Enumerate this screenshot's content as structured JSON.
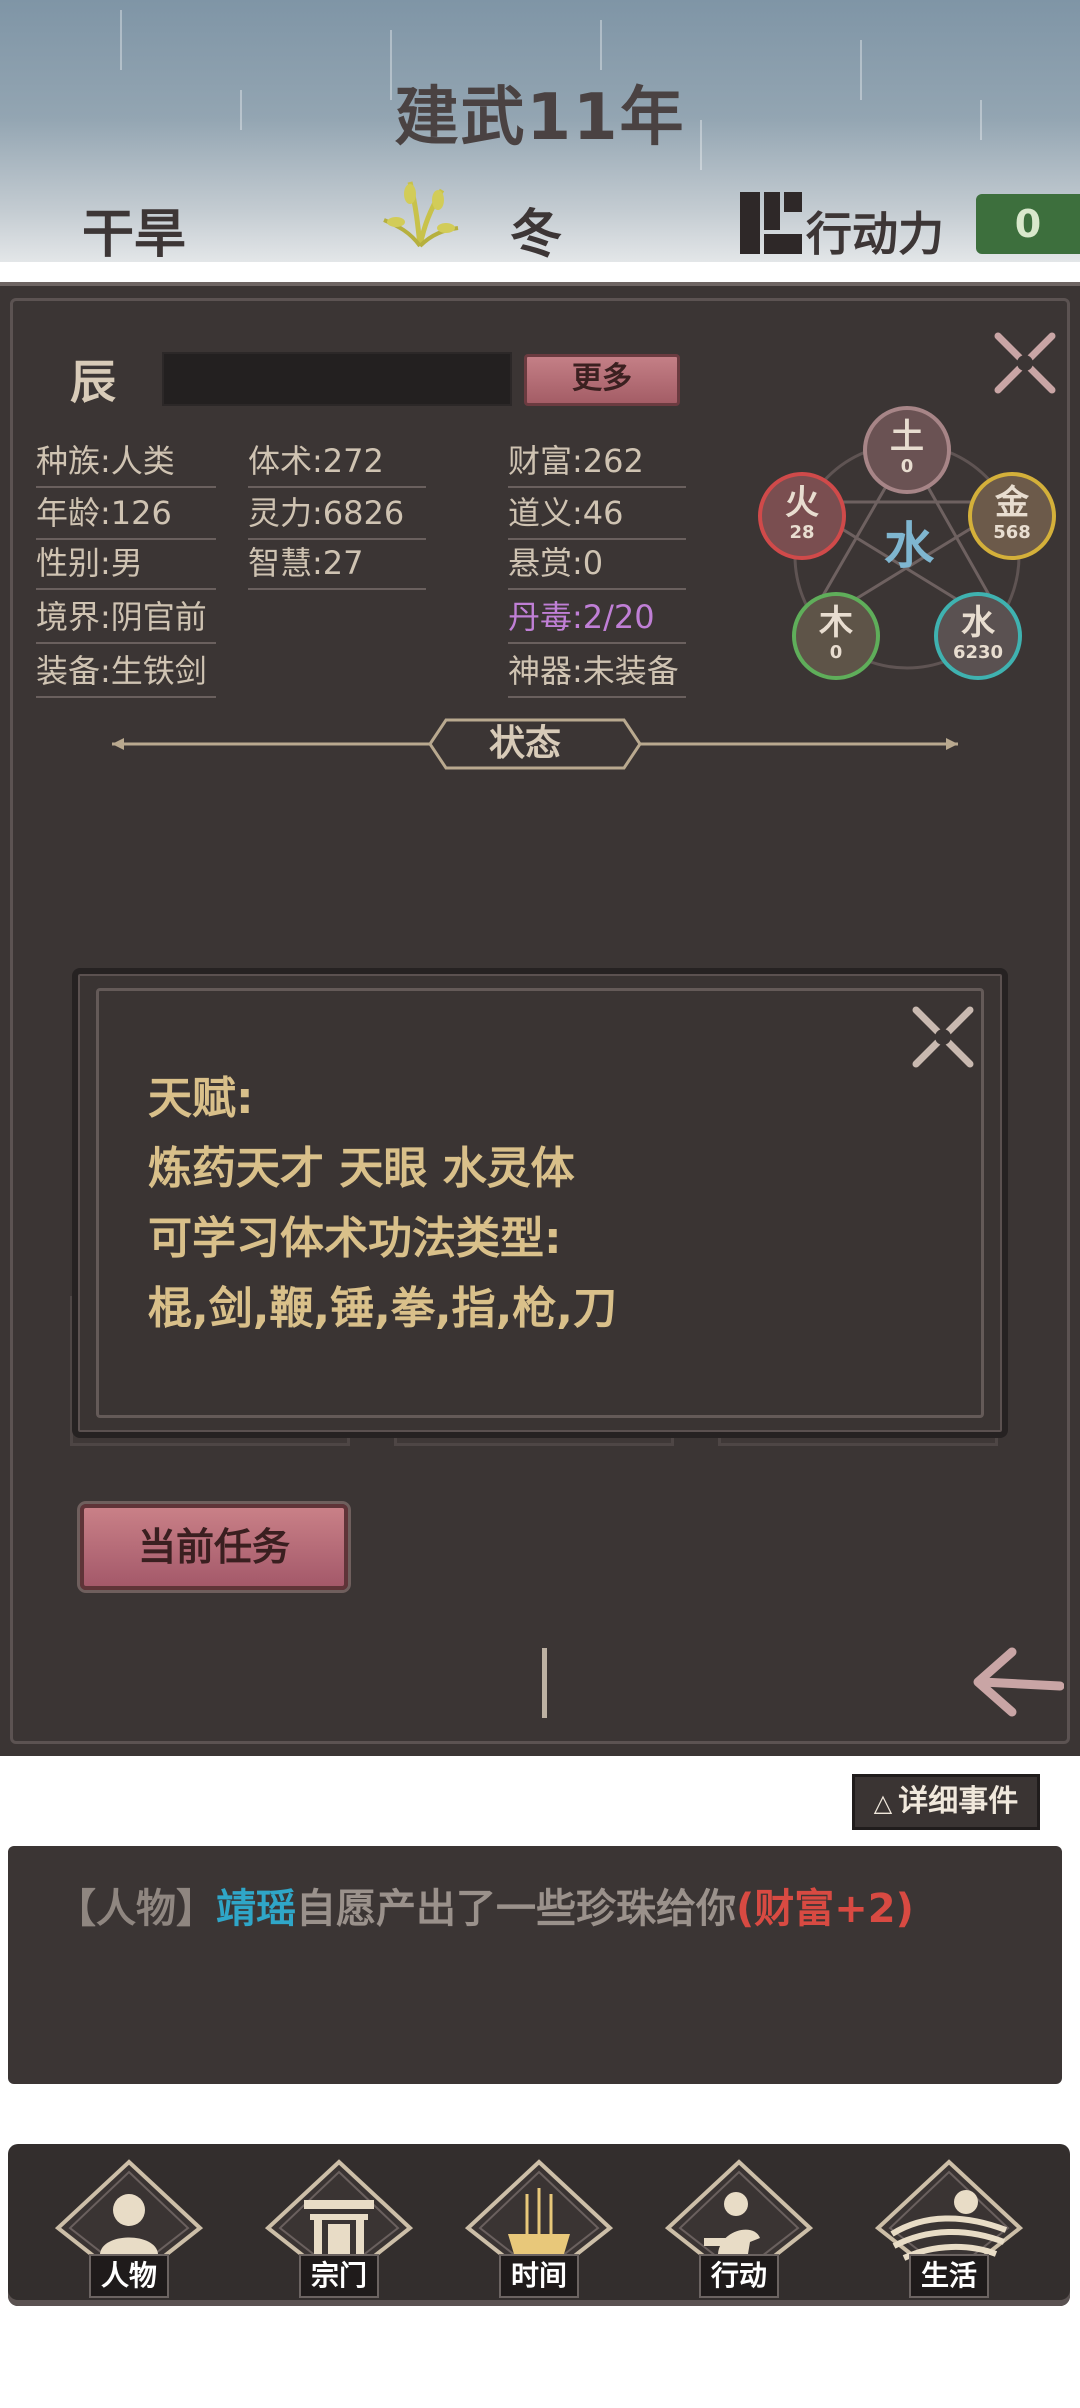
{
  "header": {
    "year_title": "建武11年",
    "weather": "干旱",
    "season": "冬",
    "action_points_label": "行动力",
    "action_points_value": "0"
  },
  "character": {
    "name": "辰",
    "more_button": "更多",
    "stats": {
      "race": "种族:人类",
      "age": "年龄:126",
      "gender": "性别:男",
      "realm": "境界:阴官前",
      "equipment": "装备:生铁剑",
      "body_art": "体术:272",
      "spirit": "灵力:6826",
      "wisdom": "智慧:27",
      "wealth": "财富:262",
      "righteousness": "道义:46",
      "bounty": "悬赏:0",
      "pill_poison": "丹毒:2/20",
      "artifact": "神器:未装备"
    },
    "status_label": "状态"
  },
  "five_elements": {
    "center": "水",
    "earth": {
      "name": "土",
      "value": "0"
    },
    "fire": {
      "name": "火",
      "value": "28"
    },
    "metal": {
      "name": "金",
      "value": "568"
    },
    "wood": {
      "name": "木",
      "value": "0"
    },
    "water": {
      "name": "水",
      "value": "6230"
    }
  },
  "talent_dialog": {
    "line1": "天赋:",
    "line2": "炼药天才  天眼  水灵体",
    "line3": "可学习体术功法类型:",
    "line4": "棍,剑,鞭,锤,拳,指,枪,刀"
  },
  "current_task_button": "当前任务",
  "events": {
    "detail_button": "详细事件",
    "log": {
      "category": "【人物】",
      "person": "靖瑶",
      "text": "自愿产出了一些珍珠给你",
      "gain": "(财富+2)"
    }
  },
  "bottom_nav": {
    "character": "人物",
    "sect": "宗门",
    "time": "时间",
    "action": "行动",
    "life": "生活"
  },
  "colors": {
    "panel": "#3b3534",
    "accent_pink": "#c47f86",
    "talent_gold": "#d9c08a",
    "poison_purple": "#c07fd6",
    "person_blue": "#2fa6c8",
    "gain_red": "#d84a42",
    "ap_green": "#3d6f3d"
  }
}
